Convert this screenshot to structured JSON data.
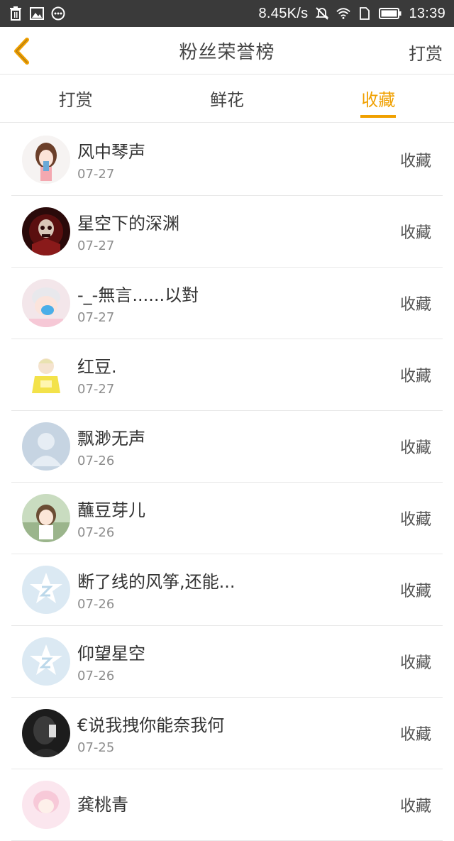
{
  "status_bar": {
    "speed": "8.45K/s",
    "time": "13:39",
    "icons": [
      "trash-icon",
      "image-icon",
      "more-icon",
      "mute-icon",
      "wifi-icon",
      "sim-icon",
      "battery-icon"
    ]
  },
  "header": {
    "title": "粉丝荣誉榜",
    "right_label": "打赏",
    "back_icon": "chevron-left-icon",
    "accent_color": "#f0a000"
  },
  "tabs": [
    {
      "label": "打赏",
      "active": false
    },
    {
      "label": "鲜花",
      "active": false
    },
    {
      "label": "收藏",
      "active": true
    }
  ],
  "rows": [
    {
      "name": "风中琴声",
      "date": "07-27",
      "action": "收藏",
      "avatar": "girl-illustration-avatar"
    },
    {
      "name": "星空下的深渊",
      "date": "07-27",
      "action": "收藏",
      "avatar": "dark-skull-avatar"
    },
    {
      "name": "-_-無言......以對",
      "date": "07-27",
      "action": "收藏",
      "avatar": "blue-hat-avatar"
    },
    {
      "name": "红豆.",
      "date": "07-27",
      "action": "收藏",
      "avatar": "yellow-sweater-avatar"
    },
    {
      "name": "飘渺无声",
      "date": "07-26",
      "action": "收藏",
      "avatar": "default-person-avatar"
    },
    {
      "name": "蘸豆芽儿",
      "date": "07-26",
      "action": "收藏",
      "avatar": "anime-girl-avatar"
    },
    {
      "name": "断了线的风筝,还能...",
      "date": "07-26",
      "action": "收藏",
      "avatar": "qzone-star-avatar"
    },
    {
      "name": "仰望星空",
      "date": "07-26",
      "action": "收藏",
      "avatar": "qzone-star-avatar"
    },
    {
      "name": "€说我拽你能奈我何",
      "date": "07-25",
      "action": "收藏",
      "avatar": "dark-photo-avatar"
    },
    {
      "name": "龚桃青",
      "date": "",
      "action": "收藏",
      "avatar": "pink-anime-avatar"
    }
  ]
}
